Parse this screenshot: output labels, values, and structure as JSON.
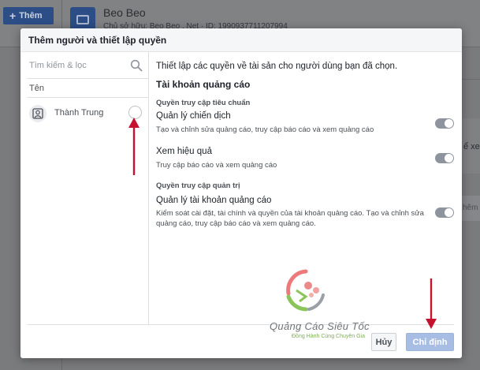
{
  "background": {
    "add_button_label": "Thêm",
    "account_name": "Beo Beo",
    "account_sub": "Chủ sở hữu: Beo Beo . Net · ID: 1990937711207994",
    "right_text_fragment": "ể xe",
    "right_button_fragment": "hêm"
  },
  "dialog": {
    "title": "Thêm người và thiết lập quyền",
    "search": {
      "placeholder": "Tìm kiếm & lọc",
      "value": ""
    },
    "column_header": "Tên",
    "people": [
      {
        "name": "Thành Trung",
        "selected": false
      }
    ],
    "intro": "Thiết lập các quyền về tài sản cho người dùng bạn đã chọn.",
    "section_title": "Tài khoản quảng cáo",
    "groups": [
      {
        "title": "Quyền truy cập tiêu chuẩn",
        "permissions": [
          {
            "title": "Quản lý chiến dịch",
            "description": "Tạo và chỉnh sửa quảng cáo, truy cập báo cáo và xem quảng cáo",
            "enabled": false
          },
          {
            "title": "Xem hiệu quả",
            "description": "Truy cập báo cáo và xem quảng cáo",
            "enabled": false
          }
        ]
      },
      {
        "title": "Quyền truy cập quản trị",
        "permissions": [
          {
            "title": "Quản lý tài khoản quảng cáo",
            "description_line1": "Kiểm soát cài đặt, tài chính và quyền của tài khoản quảng cáo. Tạo và chỉnh sửa",
            "description_line2": "quảng cáo, truy cập báo cáo và xem quảng cáo.",
            "enabled": false
          }
        ]
      }
    ],
    "watermark": {
      "name": "Quảng Cáo Siêu Tốc",
      "tagline": "Đồng Hành Cùng Chuyên Gia"
    },
    "buttons": {
      "cancel": "Hủy",
      "assign": "Chỉ định"
    }
  },
  "colors": {
    "primary": "#4267b2",
    "disabled_primary": "#a7bde3",
    "annotation_arrow": "#c4122f",
    "toggle_off": "#8d949e"
  },
  "icons": [
    "plus-icon",
    "ad-account-icon",
    "search-icon",
    "avatar-icon",
    "arrow-annotation"
  ]
}
